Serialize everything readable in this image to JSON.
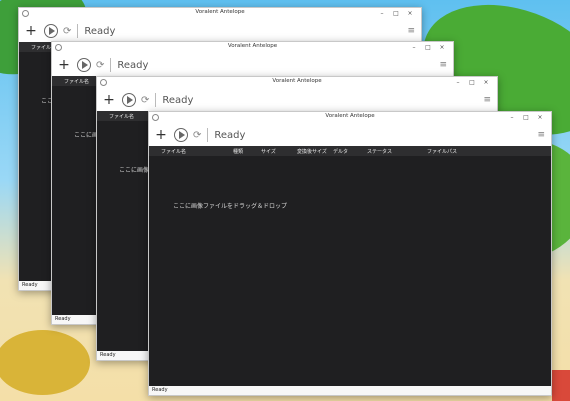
{
  "app": {
    "title": "Voralent Antelope",
    "toolbar_status": "Ready",
    "add_glyph": "+",
    "refresh_glyph": "⟳",
    "menu_glyph": "≡",
    "window_controls": {
      "minimize": "–",
      "maximize": "□",
      "close": "×"
    }
  },
  "table": {
    "headers": [
      "ファイル名",
      "種類",
      "サイズ",
      "変換後サイズ",
      "デルタ",
      "ステータス",
      "ファイルパス"
    ]
  },
  "drop_hint_full": "ここに画像ファイルをドラッグ＆ドロップ",
  "drop_hint_short": "ここに画像",
  "drop_hint_tiny": "ここに",
  "status_ready": "Ready",
  "icons": {
    "app": "app-icon",
    "add": "plus-icon",
    "play": "play-icon",
    "refresh": "refresh-icon",
    "menu": "hamburger-menu-icon"
  }
}
